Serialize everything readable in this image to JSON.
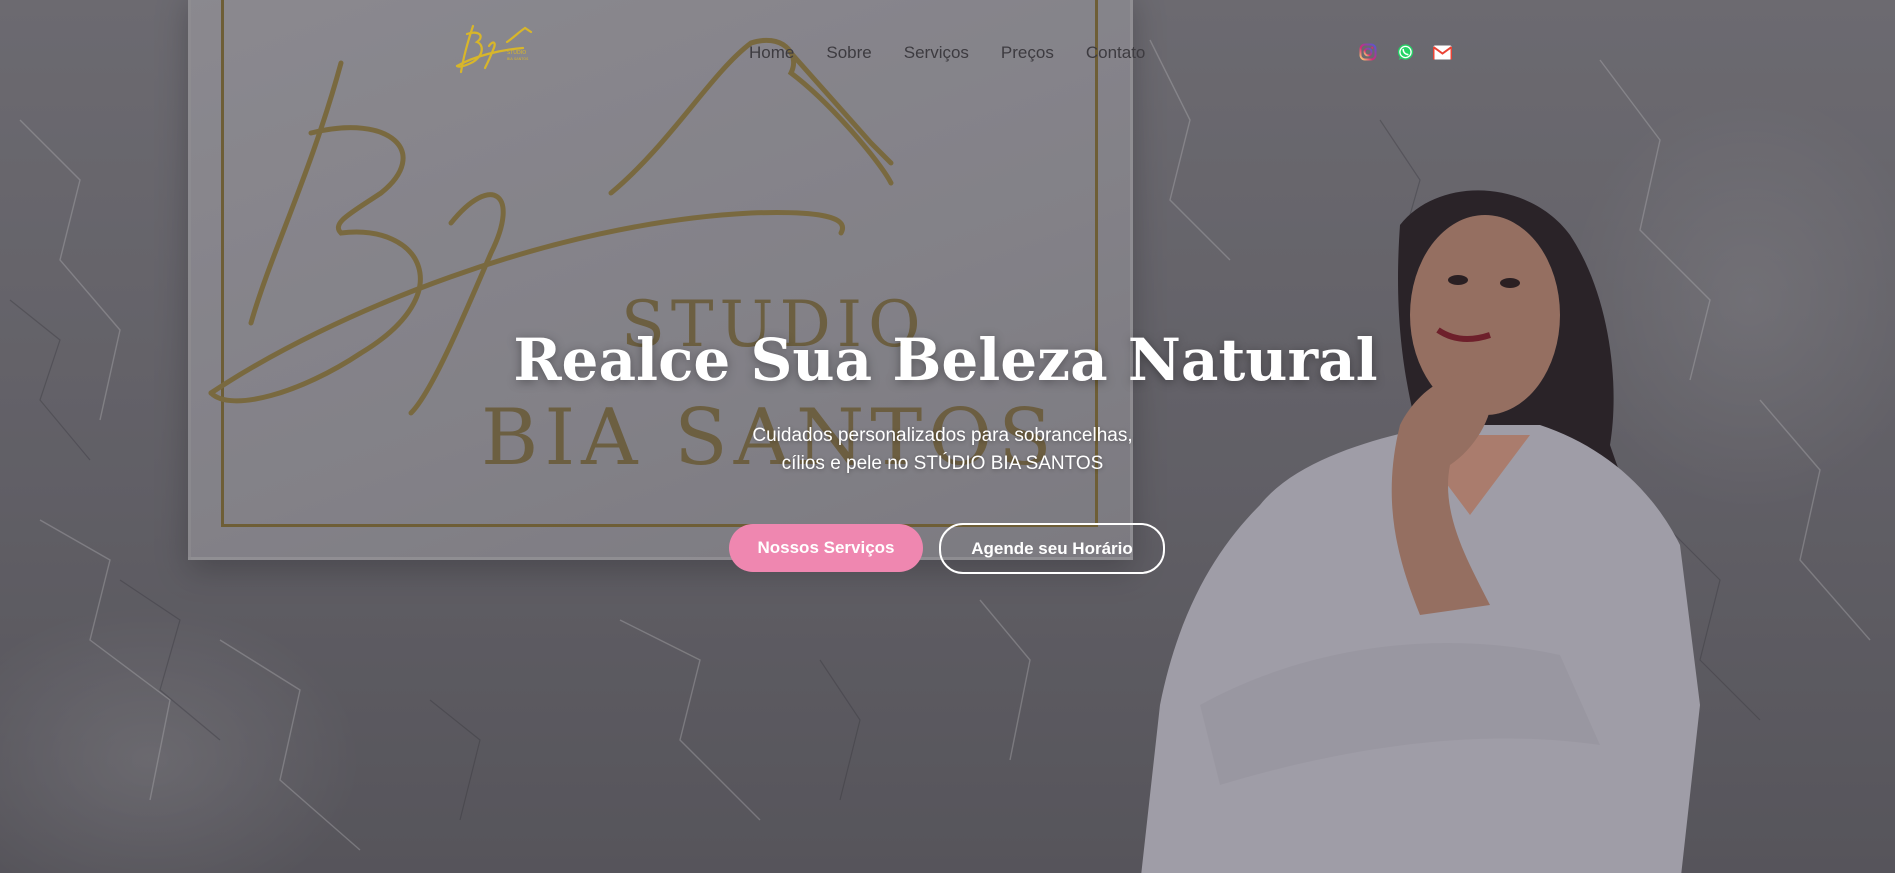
{
  "background": {
    "sign_words": [
      "STUDIO",
      "BIA SANTOS"
    ]
  },
  "header": {
    "logo_icon": "bs-studio-logo-icon",
    "nav": [
      {
        "label": "Home"
      },
      {
        "label": "Sobre"
      },
      {
        "label": "Serviços"
      },
      {
        "label": "Preços"
      },
      {
        "label": "Contato"
      }
    ],
    "socials": [
      {
        "icon": "instagram-icon",
        "color": "#d62976"
      },
      {
        "icon": "whatsapp-icon",
        "color": "#25d366"
      },
      {
        "icon": "gmail-icon",
        "color": "#ea4335"
      }
    ]
  },
  "hero": {
    "title": "Realce Sua Beleza Natural",
    "subtitle_line1": "Cuidados personalizados para sobrancelhas,",
    "subtitle_line2": "cílios e pele no STÚDIO BIA SANTOS",
    "primary_button": "Nossos Serviços",
    "secondary_button": "Agende seu Horário"
  },
  "colors": {
    "accent_pink": "#ef87b0",
    "text_white": "#ffffff",
    "logo_gold": "#d8b62a",
    "nav_text": "#3d3b40"
  }
}
